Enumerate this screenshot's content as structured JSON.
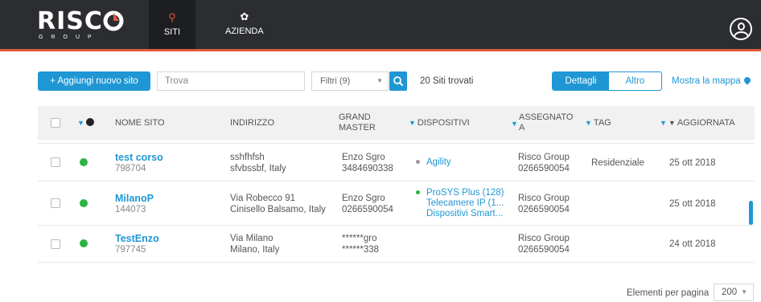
{
  "brand": {
    "word": "RISC",
    "sub": "GROUP"
  },
  "nav": [
    {
      "label": "SITI"
    },
    {
      "label": "AZIENDA"
    }
  ],
  "toolbar": {
    "add_label": "+ Aggiungi nuovo sito",
    "search_placeholder": "Trova",
    "filter_label": "Filtri (9)",
    "count_label": "20 Siti trovati",
    "view_details": "Dettagli",
    "view_other": "Altro",
    "map_label": "Mostra la mappa"
  },
  "columns": {
    "name": "NOME SITO",
    "address": "INDIRIZZO",
    "grand_master": "GRAND MASTER",
    "devices": "DISPOSITIVI",
    "assigned": "ASSEGNATO A",
    "tag": "TAG",
    "updated": "AGGIORNATA"
  },
  "rows": [
    {
      "name": "test corso",
      "id": "798704",
      "address1": "sshfhfsh",
      "address2": "sfvbssbf, Italy",
      "gm1": "Enzo Sgro",
      "gm2": "3484690338",
      "devices": [
        "Agility"
      ],
      "assigned1": "Risco Group",
      "assigned2": "0266590054",
      "tag": "Residenziale",
      "updated": "25 ott 2018"
    },
    {
      "name": "MilanoP",
      "id": "144073",
      "address1": "Via Robecco 91",
      "address2": "Cinisello Balsamo, Italy",
      "gm1": "Enzo Sgro",
      "gm2": "0266590054",
      "devices": [
        "ProSYS Plus (128)",
        "Telecamere IP (1...",
        "Dispositivi Smart..."
      ],
      "assigned1": "Risco Group",
      "assigned2": "0266590054",
      "tag": "",
      "updated": "25 ott 2018"
    },
    {
      "name": "TestEnzo",
      "id": "797745",
      "address1": "Via Milano",
      "address2": "Milano, Italy",
      "gm1": "******gro",
      "gm2": "******338",
      "devices": [],
      "assigned1": "Risco Group",
      "assigned2": "0266590054",
      "tag": "",
      "updated": "24 ott 2018"
    }
  ],
  "pager": {
    "label": "Elementi per pagina",
    "value": "200"
  },
  "colors": {
    "accent": "#1f97d4",
    "topbar": "#2b2d31",
    "underline": "#e0583e",
    "status_ok": "#2db343"
  }
}
